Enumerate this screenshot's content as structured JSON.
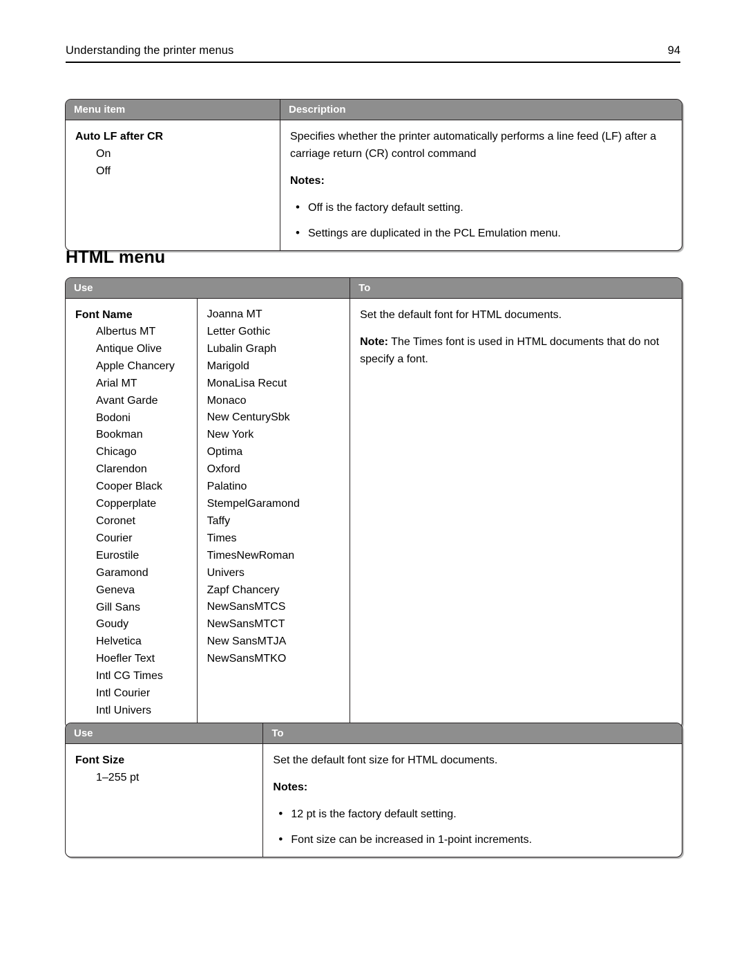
{
  "header": {
    "title": "Understanding the printer menus",
    "page_number": "94"
  },
  "section_heading": "HTML menu",
  "table_auto_lf": {
    "columns": [
      "Menu item",
      "Description"
    ],
    "menu_item": {
      "title": "Auto LF after CR",
      "options": [
        "On",
        "Off"
      ]
    },
    "description": {
      "paragraph": "Specifies whether the printer automatically performs a line feed (LF) after a carriage return (CR) control command",
      "notes_label": "Notes:",
      "notes": [
        "Off is the factory default setting.",
        "Settings are duplicated in the PCL Emulation menu."
      ]
    }
  },
  "table_font_name": {
    "columns": [
      "Use",
      "To"
    ],
    "use": {
      "title": "Font Name",
      "column1": [
        "Albertus MT",
        "Antique Olive",
        "Apple Chancery",
        "Arial MT",
        "Avant Garde",
        "Bodoni",
        "Bookman",
        "Chicago",
        "Clarendon",
        "Cooper Black",
        "Copperplate",
        "Coronet",
        "Courier",
        "Eurostile",
        "Garamond",
        "Geneva",
        "Gill Sans",
        "Goudy",
        "Helvetica",
        "Hoefler Text",
        "Intl CG Times",
        "Intl Courier",
        "Intl Univers"
      ],
      "column2": [
        "Joanna MT",
        "Letter Gothic",
        "Lubalin Graph",
        "Marigold",
        "MonaLisa Recut",
        "Monaco",
        "New CenturySbk",
        "New York",
        "Optima",
        "Oxford",
        "Palatino",
        "StempelGaramond",
        "Taffy",
        "Times",
        "TimesNewRoman",
        "Univers",
        "Zapf Chancery",
        "NewSansMTCS",
        "NewSansMTCT",
        "New SansMTJA",
        "NewSansMTKO"
      ]
    },
    "to": {
      "paragraph": "Set the default font for HTML documents.",
      "note_label": "Note:",
      "note_text": " The Times font is used in HTML documents that do not specify a font."
    }
  },
  "table_font_size": {
    "columns": [
      "Use",
      "To"
    ],
    "use": {
      "title": "Font Size",
      "options": [
        "1–255 pt"
      ]
    },
    "to": {
      "paragraph": "Set the default font size for HTML documents.",
      "notes_label": "Notes:",
      "notes": [
        "12 pt is the factory default setting.",
        "Font size can be increased in 1-point increments."
      ]
    }
  }
}
